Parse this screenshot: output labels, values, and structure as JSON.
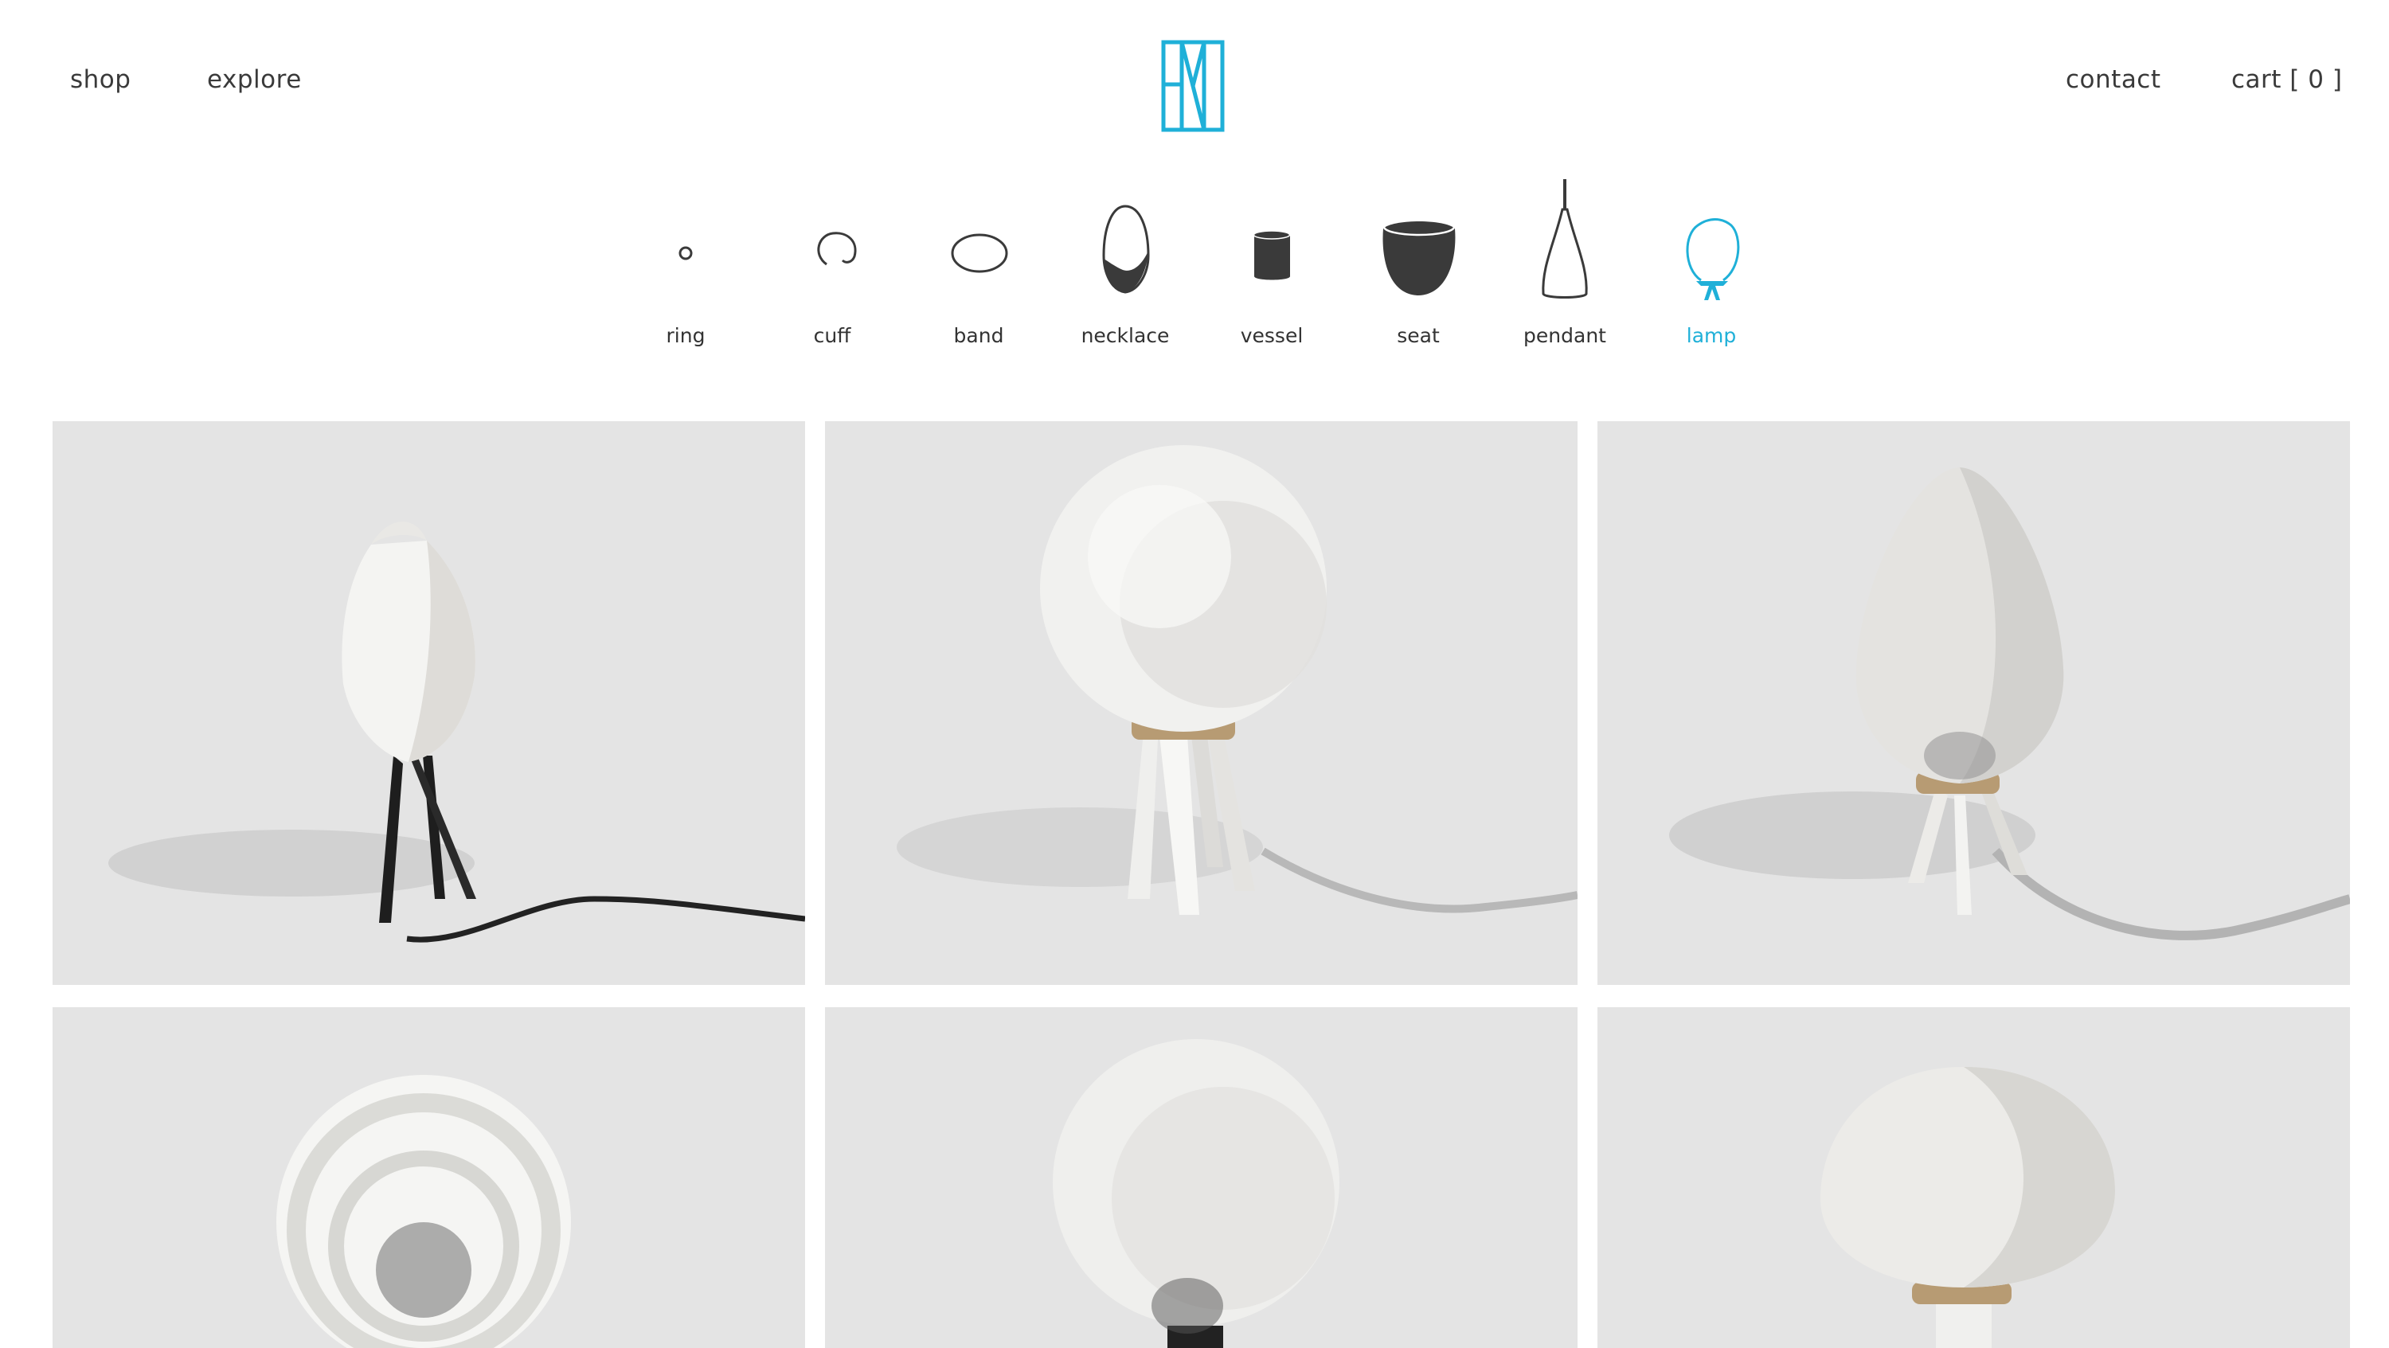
{
  "header": {
    "nav_left": [
      {
        "label": "shop"
      },
      {
        "label": "explore"
      }
    ],
    "nav_right": [
      {
        "label": "contact"
      },
      {
        "label": "cart [ 0 ]"
      }
    ],
    "logo_icon": "fw-monogram-icon"
  },
  "categories": {
    "active": "lamp",
    "items": [
      {
        "label": "ring",
        "icon": "ring-icon"
      },
      {
        "label": "cuff",
        "icon": "cuff-icon"
      },
      {
        "label": "band",
        "icon": "band-icon"
      },
      {
        "label": "necklace",
        "icon": "necklace-icon"
      },
      {
        "label": "vessel",
        "icon": "vessel-icon"
      },
      {
        "label": "seat",
        "icon": "seat-icon"
      },
      {
        "label": "pendant",
        "icon": "pendant-icon"
      },
      {
        "label": "lamp",
        "icon": "lamp-icon"
      }
    ]
  },
  "products": [
    {
      "shade": "diamond",
      "stand": "black-tripod"
    },
    {
      "shade": "sphere",
      "stand": "white-tripod"
    },
    {
      "shade": "egg",
      "stand": "white-tripod"
    },
    {
      "shade": "sphere",
      "stand": "dark-stand"
    },
    {
      "shade": "sphere",
      "stand": "dark-stand"
    },
    {
      "shade": "flat-sphere",
      "stand": "white-stand"
    }
  ],
  "colors": {
    "accent": "#1fb0d8",
    "text": "#333333",
    "tile_bg": "#e4e4e4",
    "icon_dark": "#3a3a3a"
  }
}
